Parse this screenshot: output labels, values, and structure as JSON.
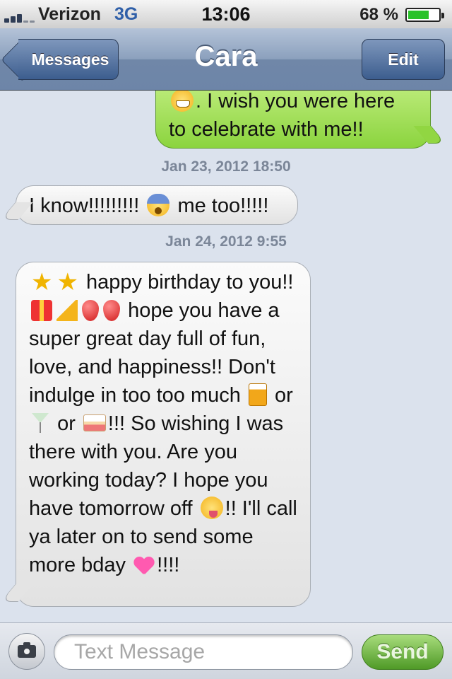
{
  "status_bar": {
    "carrier": "Verizon",
    "network": "3G",
    "time": "13:06",
    "battery_percent": "68 %",
    "battery_level": 0.68
  },
  "nav": {
    "back_label": "Messages",
    "title": "Cara",
    "edit_label": "Edit"
  },
  "messages": [
    {
      "direction": "sent",
      "parts": [
        "grinning-emoji",
        ". I wish you were here to celebrate with me!!"
      ]
    },
    {
      "timestamp": "Jan 23, 2012 18:50",
      "direction": "received",
      "text_1": "I know!!!!!!!!!",
      "emoji_1": "fearful-face-emoji",
      "text_2": "me too!!!!!"
    },
    {
      "timestamp": "Jan 24, 2012 9:55",
      "direction": "received",
      "segments": {
        "a": "happy birthday to you!!",
        "b": "hope you have a super great day full of fun, love, and happiness!! Don't indulge in too too much",
        "c": "or",
        "d": "or",
        "e": "!!! So wishing I was there with you. Are you working today? I hope you have tomorrow off",
        "f": "!! I'll call ya later on to send some more bday",
        "g": "!!!!"
      },
      "emojis": [
        "star-emoji",
        "star-emoji",
        "gift-emoji",
        "party-popper-emoji",
        "balloon-emoji",
        "balloon-emoji",
        "beer-mug-emoji",
        "martini-emoji",
        "cake-emoji",
        "winking-tongue-emoji",
        "pink-heart-emoji"
      ]
    }
  ],
  "input_bar": {
    "placeholder": "Text Message",
    "send_label": "Send"
  }
}
